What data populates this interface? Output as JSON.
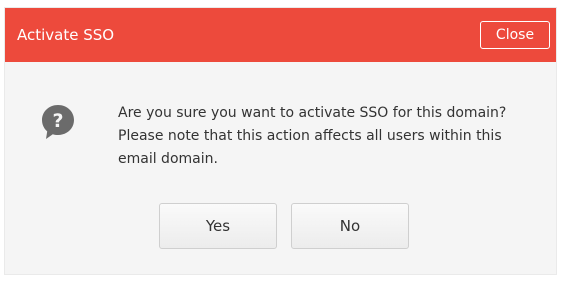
{
  "dialog": {
    "title": "Activate SSO",
    "close_label": "Close",
    "message": "Are you sure you want to activate SSO for this domain? Please note that this action affects all users within this email domain.",
    "icon": "question-bubble-icon",
    "buttons": {
      "yes_label": "Yes",
      "no_label": "No"
    }
  },
  "colors": {
    "header": "#ed4a3c",
    "body": "#f5f5f5",
    "icon": "#6b6b6b"
  }
}
